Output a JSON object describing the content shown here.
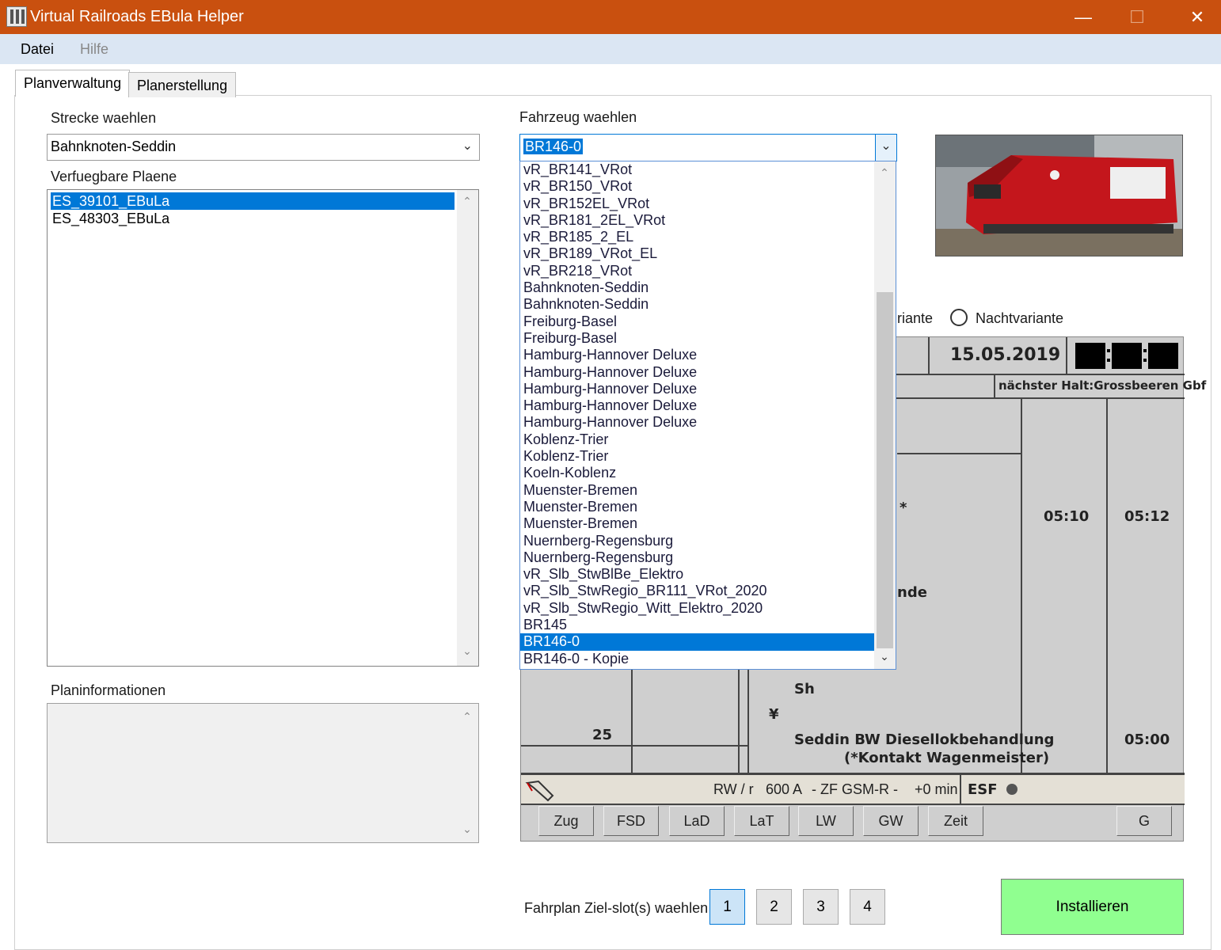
{
  "window": {
    "title": "Virtual Railroads EBula Helper",
    "minimize": "—",
    "maximize": "☐",
    "close": "✕"
  },
  "menu": {
    "datei": "Datei",
    "hilfe": "Hilfe"
  },
  "tabs": {
    "planverwaltung": "Planverwaltung",
    "planerstellung": "Planerstellung"
  },
  "strecke": {
    "label": "Strecke waehlen",
    "value": "Bahnknoten-Seddin"
  },
  "plaene": {
    "label": "Verfuegbare Plaene",
    "items": [
      "ES_39101_EBuLa",
      "ES_48303_EBuLa"
    ],
    "selected_index": 0
  },
  "planinfo": {
    "label": "Planinformationen"
  },
  "fahrzeug": {
    "label": "Fahrzeug waehlen",
    "value": "BR146-0",
    "options": [
      "vR_BR141_VRot",
      "vR_BR150_VRot",
      "vR_BR152EL_VRot",
      "vR_BR181_2EL_VRot",
      "vR_BR185_2_EL",
      "vR_BR189_VRot_EL",
      "vR_BR218_VRot",
      "Bahnknoten-Seddin",
      "Bahnknoten-Seddin",
      "Freiburg-Basel",
      "Freiburg-Basel",
      "Hamburg-Hannover Deluxe",
      "Hamburg-Hannover Deluxe",
      "Hamburg-Hannover Deluxe",
      "Hamburg-Hannover Deluxe",
      "Hamburg-Hannover Deluxe",
      "Koblenz-Trier",
      "Koblenz-Trier",
      "Koeln-Koblenz",
      "Muenster-Bremen",
      "Muenster-Bremen",
      "Muenster-Bremen",
      "Nuernberg-Regensburg",
      "Nuernberg-Regensburg",
      "vR_Slb_StwBlBe_Elektro",
      "vR_Slb_StwRegio_BR111_VRot_2020",
      "vR_Slb_StwRegio_Witt_Elektro_2020",
      "BR145",
      "BR146-0",
      "BR146-0 - Kopie"
    ],
    "selected_index": 28
  },
  "variante": {
    "tag_partial": "riante",
    "nacht": "Nachtvariante"
  },
  "ebula": {
    "date": "15.05.2019",
    "next_stop": "nächster Halt:Grossbeeren Gbf",
    "time_arr": "05:10",
    "time_dep": "05:12",
    "star": "*",
    "nde": "nde",
    "km": "25",
    "sh": "Sh",
    "yen": "¥",
    "station": "Seddin BW Diesellokbehandlung",
    "station_note": "(*Kontakt Wagenmeister)",
    "time_station": "05:00",
    "status_left": "RW / r",
    "status_a": "600 A",
    "status_zf": "- ZF GSM-R -",
    "status_min": "+0 min",
    "esf": "ESF",
    "keys": [
      "Zug",
      "FSD",
      "LaD",
      "LaT",
      "LW",
      "GW",
      "Zeit",
      "G"
    ]
  },
  "slots": {
    "label": "Fahrplan Ziel-slot(s) waehlen",
    "items": [
      "1",
      "2",
      "3",
      "4"
    ],
    "active": "1"
  },
  "install_button": "Installieren",
  "colors": {
    "titlebar": "#c9500f",
    "menubar": "#dbe6f3",
    "selection": "#0078d7",
    "install": "#90ff90",
    "ebula_bg": "#cfcfcf"
  }
}
